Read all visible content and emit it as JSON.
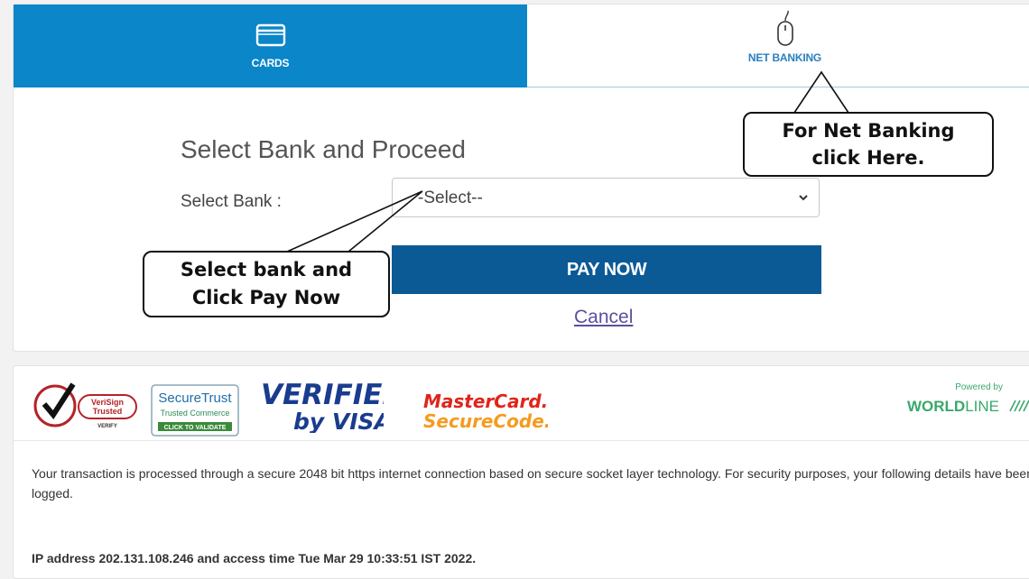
{
  "tabs": {
    "cards": {
      "label": "CARDS",
      "icon": "card-icon",
      "active": true
    },
    "net_banking": {
      "label": "NET BANKING",
      "icon": "mouse-icon",
      "active": false
    }
  },
  "form": {
    "heading": "Select Bank and Proceed",
    "bank_label": "Select Bank :",
    "bank_select_value": "-Select--",
    "pay_button": "PAY NOW",
    "cancel_link": "Cancel"
  },
  "callouts": {
    "net_banking_line1": "For Net Banking",
    "net_banking_line2": "click Here.",
    "select_bank_line1": "Select bank and",
    "select_bank_line2": "Click Pay Now"
  },
  "security": {
    "verisign_line1": "VeriSign",
    "verisign_line2": "Trusted",
    "verisign_foot": "VERIFY",
    "securetrust_title": "SecureTrust",
    "securetrust_sub": "Trusted Commerce",
    "securetrust_cta": "CLICK TO VALIDATE",
    "visa_line1": "VERIFIED",
    "visa_line2": "by VISA",
    "mastercard_line1": "MasterCard.",
    "mastercard_line2": "SecureCode.",
    "powered_by": "Powered by",
    "worldline_bold": "WORLD",
    "worldline_light": "LINE"
  },
  "notice": "Your transaction is processed through a secure 2048 bit https internet connection based on secure socket layer technology. For security purposes, your following details have been logged.",
  "ip_line": "IP address 202.131.108.246 and access time Tue Mar 29 10:33:51 IST 2022.",
  "colors": {
    "active_tab": "#0a86c9",
    "pay_button": "#0b5a96",
    "link": "#5a4fa0",
    "mastercard_red": "#e0241b",
    "mastercard_orange": "#f59b1f",
    "visa_blue": "#1a3c8f"
  }
}
